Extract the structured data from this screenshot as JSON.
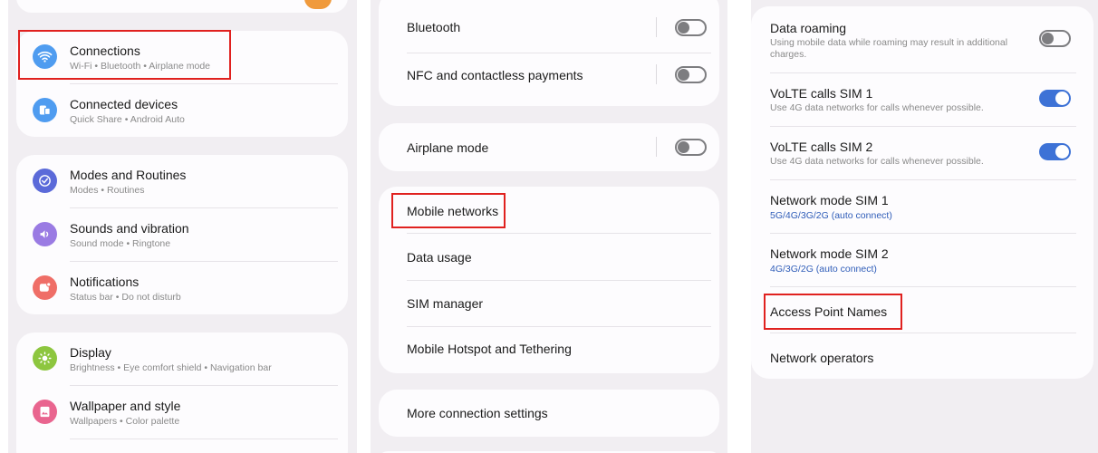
{
  "panel1": {
    "items": [
      {
        "title": "Connections",
        "sub": "Wi-Fi  •  Bluetooth  •  Airplane mode",
        "icon": "wifi-icon",
        "color": "#4f9cf0"
      },
      {
        "title": "Connected devices",
        "sub": "Quick Share  •  Android Auto",
        "icon": "devices-icon",
        "color": "#4f9cf0"
      },
      {
        "title": "Modes and Routines",
        "sub": "Modes  •  Routines",
        "icon": "check-circle-icon",
        "color": "#5b6ad9"
      },
      {
        "title": "Sounds and vibration",
        "sub": "Sound mode  •  Ringtone",
        "icon": "volume-icon",
        "color": "#9a7be3"
      },
      {
        "title": "Notifications",
        "sub": "Status bar  •  Do not disturb",
        "icon": "notification-icon",
        "color": "#ef6e67"
      },
      {
        "title": "Display",
        "sub": "Brightness  •  Eye comfort shield  •  Navigation bar",
        "icon": "sun-icon",
        "color": "#8dc63f"
      },
      {
        "title": "Wallpaper and style",
        "sub": "Wallpapers  •  Color palette",
        "icon": "wallpaper-icon",
        "color": "#e9658f"
      }
    ]
  },
  "panel2": {
    "rows": {
      "bluetooth": "Bluetooth",
      "nfc": "NFC and contactless payments",
      "airplane": "Airplane mode",
      "mobile_networks": "Mobile networks",
      "data_usage": "Data usage",
      "sim_manager": "SIM manager",
      "hotspot": "Mobile Hotspot and Tethering",
      "more": "More connection settings"
    },
    "toggles": {
      "bluetooth": false,
      "nfc": false,
      "airplane": false
    }
  },
  "panel3": {
    "data_roaming": {
      "title": "Data roaming",
      "sub1": "Using mobile data while roaming may result in additional",
      "sub2": "charges.",
      "on": false
    },
    "volte1": {
      "title": "VoLTE calls SIM 1",
      "sub": "Use 4G data networks for calls whenever possible.",
      "on": true
    },
    "volte2": {
      "title": "VoLTE calls SIM 2",
      "sub": "Use 4G data networks for calls whenever possible.",
      "on": true
    },
    "netmode1": {
      "title": "Network mode SIM 1",
      "value": "5G/4G/3G/2G (auto connect)"
    },
    "netmode2": {
      "title": "Network mode SIM 2",
      "value": "4G/3G/2G (auto connect)"
    },
    "apn": "Access Point Names",
    "operators": "Network operators"
  },
  "colors": {
    "highlight": "#e0211f",
    "toggle_on": "#3d72d6",
    "panel_bg": "#f1eef2",
    "card_bg": "#fdfcfe",
    "value_blue": "#2e5cb8"
  }
}
